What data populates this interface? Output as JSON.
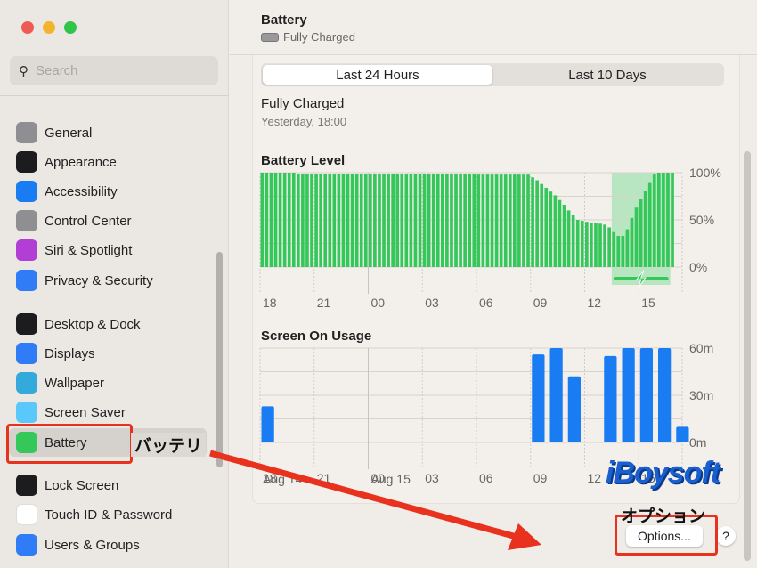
{
  "window": {
    "controls": [
      "close",
      "minimize",
      "zoom"
    ]
  },
  "sidebar": {
    "search_placeholder": "Search",
    "items": [
      {
        "label": "General",
        "icon": "gear-icon",
        "color": "#8e8e93",
        "y": 149
      },
      {
        "label": "Appearance",
        "icon": "appearance-icon",
        "color": "#1c1c1e",
        "y": 182
      },
      {
        "label": "Accessibility",
        "icon": "accessibility-icon",
        "color": "#1a7cf2",
        "y": 215
      },
      {
        "label": "Control Center",
        "icon": "control-center-icon",
        "color": "#8e8e93",
        "y": 248
      },
      {
        "label": "Siri & Spotlight",
        "icon": "siri-icon",
        "color": "#b13fd6",
        "y": 281
      },
      {
        "label": "Privacy & Security",
        "icon": "hand-icon",
        "color": "#2f7cf6",
        "y": 315
      },
      {
        "label": "Desktop & Dock",
        "icon": "dock-icon",
        "color": "#1c1c1e",
        "y": 364
      },
      {
        "label": "Displays",
        "icon": "sun-icon",
        "color": "#2f7cf6",
        "y": 397
      },
      {
        "label": "Wallpaper",
        "icon": "flower-icon",
        "color": "#34aadc",
        "y": 430
      },
      {
        "label": "Screen Saver",
        "icon": "screen-saver-icon",
        "color": "#5ac8fa",
        "y": 463
      },
      {
        "label": "Battery",
        "icon": "battery-icon",
        "color": "#34c759",
        "y": 497,
        "selected": true
      },
      {
        "label": "Lock Screen",
        "icon": "lock-icon",
        "color": "#1c1c1e",
        "y": 545
      },
      {
        "label": "Touch ID & Password",
        "icon": "fingerprint-icon",
        "color": "#ffffff",
        "y": 578
      },
      {
        "label": "Users & Groups",
        "icon": "users-icon",
        "color": "#2f7cf6",
        "y": 612
      }
    ]
  },
  "header": {
    "title": "Battery",
    "status": "Fully Charged"
  },
  "tabs": [
    {
      "label": "Last 24 Hours",
      "active": true
    },
    {
      "label": "Last 10 Days",
      "active": false
    }
  ],
  "status": {
    "title": "Fully Charged",
    "time": "Yesterday, 18:00"
  },
  "chart_data": [
    {
      "type": "bar",
      "title": "Battery Level",
      "unit": "%",
      "ylim": [
        0,
        100
      ],
      "yticks": [
        "100%",
        "50%",
        "0%"
      ],
      "xticks": [
        "18",
        "21",
        "00",
        "03",
        "06",
        "09",
        "12",
        "15"
      ],
      "interval": "15 min",
      "start": "18:00",
      "charging_range": [
        "13:30",
        "16:45"
      ],
      "color": "#34c759",
      "values": [
        100,
        100,
        100,
        100,
        100,
        100,
        100,
        100,
        99,
        99,
        99,
        99,
        99,
        99,
        99,
        99,
        99,
        99,
        99,
        99,
        99,
        99,
        99,
        99,
        99,
        99,
        99,
        99,
        99,
        99,
        99,
        99,
        99,
        99,
        99,
        99,
        99,
        99,
        99,
        99,
        99,
        99,
        99,
        99,
        99,
        99,
        99,
        99,
        98,
        98,
        98,
        98,
        98,
        98,
        98,
        98,
        98,
        98,
        98,
        98,
        95,
        92,
        88,
        84,
        80,
        76,
        71,
        66,
        60,
        55,
        50,
        49,
        48,
        47,
        47,
        46,
        45,
        42,
        37,
        33,
        33,
        40,
        52,
        63,
        72,
        81,
        90,
        98,
        100,
        100,
        100,
        100
      ]
    },
    {
      "type": "bar",
      "title": "Screen On Usage",
      "unit": "m",
      "ylim": [
        0,
        60
      ],
      "yticks": [
        "60m",
        "30m",
        "0m"
      ],
      "xticks": [
        "18",
        "21",
        "00",
        "03",
        "06",
        "09",
        "12",
        "15"
      ],
      "date_labels": [
        "Aug 14",
        "Aug 15"
      ],
      "interval": "1 hour",
      "start": "18:00",
      "color": "#1a7cf2",
      "values": [
        23,
        0,
        0,
        0,
        0,
        0,
        0,
        0,
        0,
        0,
        0,
        0,
        0,
        0,
        0,
        56,
        60,
        42,
        0,
        55,
        60,
        60,
        60,
        10
      ]
    }
  ],
  "footer": {
    "options_label": "Options...",
    "help_label": "?"
  },
  "annotations": {
    "battery_label": "バッテリ",
    "options_label": "オプション",
    "watermark": "iBoysoft",
    "accent": "#e8321e"
  }
}
